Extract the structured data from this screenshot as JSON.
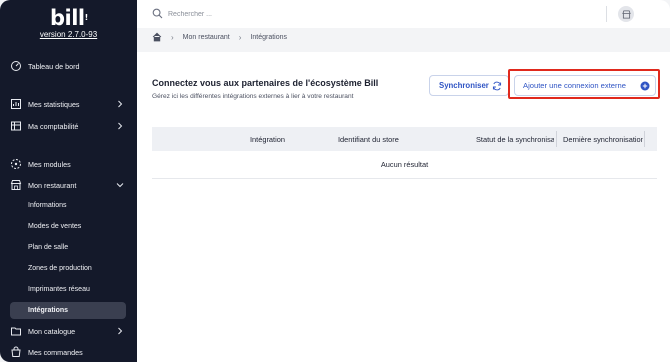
{
  "app": {
    "logo_text": "bill",
    "version": "version 2.7.0-93"
  },
  "sidebar": {
    "items": [
      {
        "label": "Tableau de bord",
        "icon": "dashboard-icon"
      },
      {
        "label": "Mes statistiques",
        "icon": "stats-icon"
      },
      {
        "label": "Ma comptabilité",
        "icon": "accounting-icon"
      },
      {
        "label": "Mes modules",
        "icon": "modules-icon"
      },
      {
        "label": "Mon restaurant",
        "icon": "store-icon"
      },
      {
        "label": "Mon catalogue",
        "icon": "catalog-icon"
      },
      {
        "label": "Mes commandes",
        "icon": "orders-icon"
      }
    ],
    "restaurant_sub": [
      {
        "label": "Informations"
      },
      {
        "label": "Modes de ventes"
      },
      {
        "label": "Plan de salle"
      },
      {
        "label": "Zones de production"
      },
      {
        "label": "Imprimantes réseau"
      },
      {
        "label": "Intégrations",
        "active": true
      }
    ]
  },
  "topbar": {
    "search_placeholder": "Rechercher ..."
  },
  "breadcrumb": [
    "Mon restaurant",
    "Intégrations"
  ],
  "page": {
    "title": "Connectez vous aux partenaires de l'écosystème Bill",
    "subtitle": "Gérez ici les différentes intégrations externes à lier à votre restaurant",
    "sync_label": "Synchroniser",
    "add_label": "Ajouter une connexion externe"
  },
  "table": {
    "columns": [
      "Intégration",
      "Identifiant du store",
      "Statut de la synchronisation",
      "Dernière synchronisation"
    ],
    "empty_text": "Aucun résultat"
  },
  "colors": {
    "sidebar_bg": "#14192a",
    "accent": "#2f54c4",
    "highlight": "#e0291d"
  }
}
